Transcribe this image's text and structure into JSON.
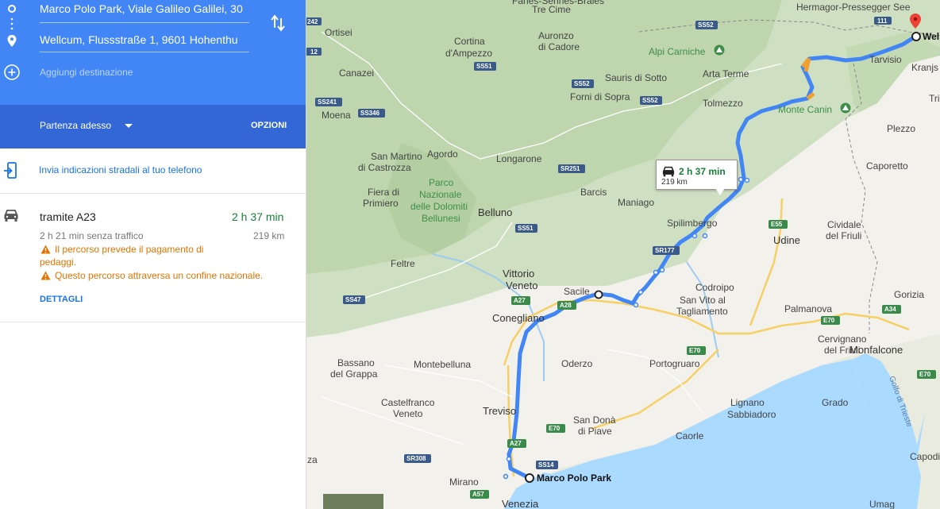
{
  "directions": {
    "origin": "Marco Polo Park, Viale Galileo Galilei, 30",
    "destination": "Wellcum, Flussstraße 1, 9601 Hohenthu",
    "add_destination": "Aggiungi destinazione",
    "departure": "Partenza adesso",
    "options": "OPZIONI",
    "send_to_phone": "Invia indicazioni stradali al tuo telefono"
  },
  "route": {
    "via": "tramite A23",
    "duration": "2 h 37 min",
    "duration_no_traffic": "2 h 21 min senza traffico",
    "distance": "219 km",
    "warning_tolls": "Il percorso prevede il pagamento di pedaggi.",
    "warning_tolls_line1": "Il percorso prevede il pagamento di",
    "warning_tolls_line2": "pedaggi.",
    "warning_border": "Questo percorso attraversa un confine nazionale.",
    "details": "DETTAGLI"
  },
  "map": {
    "info_duration": "2 h 37 min",
    "info_distance": "219 km",
    "origin_label": "Marco Polo Park",
    "destination_label": "Wel",
    "places": {
      "hermagor": "Hermagor-Pressegger See",
      "tre_cime": "Tre Cime",
      "fanes": "Fanes-Sennes-Braies",
      "ortisei": "Ortisei",
      "cortina": "Cortina",
      "ampezzo": "d'Ampezzo",
      "auronzo": "Auronzo",
      "cadore": "di Cadore",
      "alpi_carniche": "Alpi Carniche",
      "tarvisio": "Tarvisio",
      "kranjs": "Kranjs",
      "canazei": "Canazei",
      "sauris": "Sauris di Sotto",
      "forni": "Forni di Sopra",
      "arta": "Arta Terme",
      "tolmezzo": "Tolmezzo",
      "monte_canin": "Monte Canin",
      "trigl": "Trigl",
      "moena": "Moena",
      "agordo": "Agordo",
      "plezzo": "Plezzo",
      "san_martino": "San Martino",
      "castrozza": "di Castrozza",
      "longarone": "Longarone",
      "caporetto": "Caporetto",
      "parco1": "Parco",
      "parco2": "Nazionale",
      "parco3": "delle Dolomiti",
      "parco4": "Bellunesi",
      "barcis": "Barcis",
      "fiera": "Fiera di",
      "primiero": "Primiero",
      "belluno": "Belluno",
      "maniago": "Maniago",
      "spilimbergo": "Spilimbergo",
      "udine": "Udine",
      "cividale1": "Cividale",
      "cividale2": "del Friuli",
      "feltre": "Feltre",
      "vittorio1": "Vittorio",
      "vittorio2": "Veneto",
      "sacile": "Sacile",
      "codroipo": "Codroipo",
      "san_vito1": "San Vito al",
      "san_vito2": "Tagliamento",
      "palmanova": "Palmanova",
      "gorizia": "Gorizia",
      "conegliano": "Conegliano",
      "cervignano1": "Cervignano",
      "cervignano2": "del Friuli",
      "monfalcone": "Monfalcone",
      "bassano1": "Bassano",
      "bassano2": "del Grappa",
      "montebelluna": "Montebelluna",
      "oderzo": "Oderzo",
      "portogruaro": "Portogruaro",
      "castelfranco1": "Castelfranco",
      "castelfranco2": "Veneto",
      "treviso": "Treviso",
      "san_dona1": "San Donà",
      "san_dona2": "di Piave",
      "lignano": "Lignano",
      "sabbiadoro": "Sabbiadoro",
      "grado": "Grado",
      "caorle": "Caorle",
      "golfo": "Golfo di Trieste",
      "mirano": "Mirano",
      "venezia": "Venezia",
      "capodi": "Capodi",
      "umag": "Umag",
      "za": "za"
    },
    "shields": {
      "s242": "242",
      "s12": "12",
      "ss52a": "SS52",
      "ss51a": "SS51",
      "ss52b": "SS52",
      "ss52c": "SS52",
      "ss241": "SS241",
      "ss346": "SS346",
      "sr251": "SR251",
      "ss51b": "SS51",
      "sr177": "SR177",
      "e55": "E55",
      "a27a": "A27",
      "a28": "A28",
      "ss47": "SS47",
      "e70a": "E70",
      "a34": "A34",
      "e70b": "E70",
      "e70c": "E70",
      "a27b": "A27",
      "e70d": "E70",
      "sr308": "SR308",
      "ss14": "SS14",
      "a57": "A57",
      "s111": "111"
    }
  }
}
